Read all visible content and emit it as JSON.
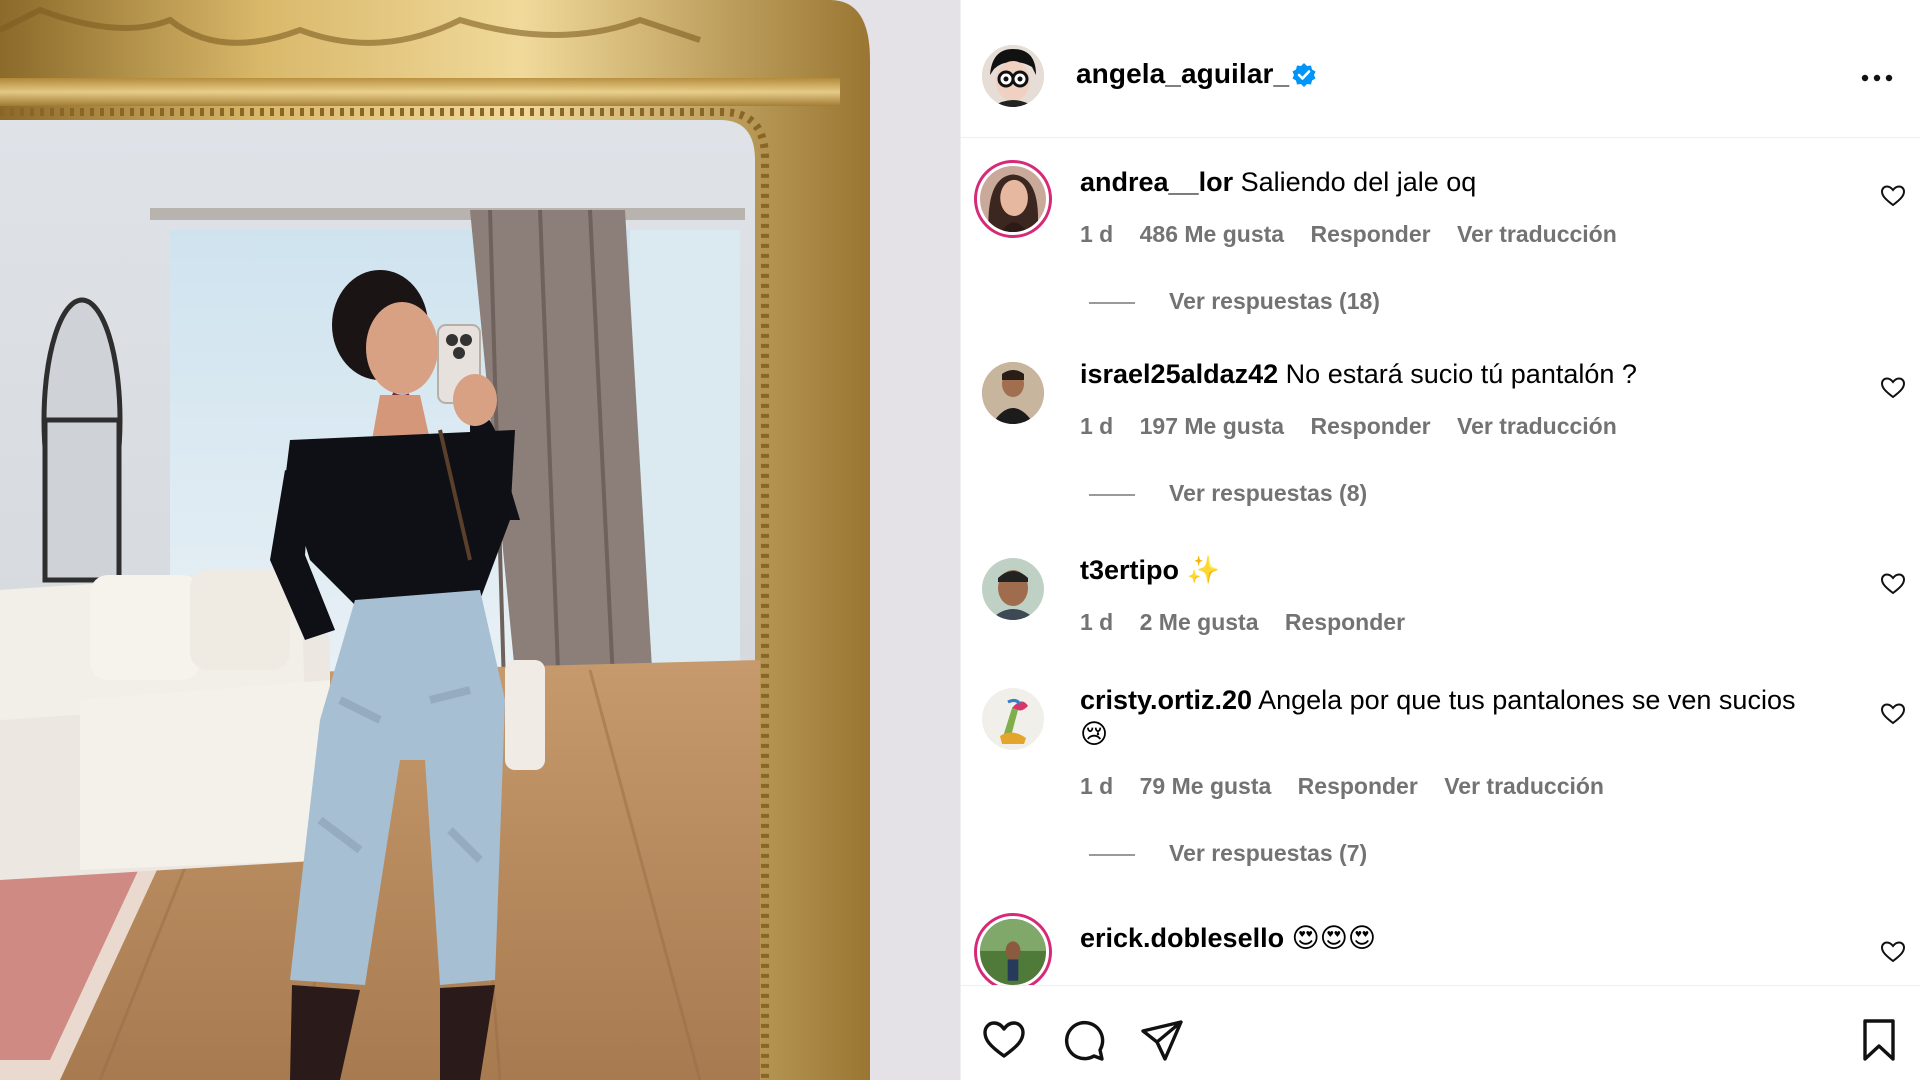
{
  "post": {
    "author": "angela_aguilar_",
    "verified": true,
    "more_icon": "more-horizontal-icon"
  },
  "comments": [
    {
      "user": "andrea__lor",
      "text": "Saliendo del jale oq",
      "time": "1 d",
      "likes": "486 Me gusta",
      "reply": "Responder",
      "translate": "Ver traducción",
      "replies": "Ver respuestas (18)",
      "story_ring": true
    },
    {
      "user": "israel25aldaz42",
      "text": "No estará sucio tú pantalón ?",
      "time": "1 d",
      "likes": "197 Me gusta",
      "reply": "Responder",
      "translate": "Ver traducción",
      "replies": "Ver respuestas (8)",
      "story_ring": false
    },
    {
      "user": "t3ertipo",
      "text": "✨",
      "time": "1 d",
      "likes": "2 Me gusta",
      "reply": "Responder",
      "story_ring": false
    },
    {
      "user": "cristy.ortiz.20",
      "text": "Angela por que tus pantalones se ven sucios 😢",
      "time": "1 d",
      "likes": "79 Me gusta",
      "reply": "Responder",
      "translate": "Ver traducción",
      "replies": "Ver respuestas (7)",
      "story_ring": false
    },
    {
      "user": "erick.doblesello",
      "text": "😍😍😍",
      "story_ring": true
    }
  ],
  "actions": [
    "heart-icon",
    "comment-icon",
    "share-icon",
    "bookmark-icon"
  ],
  "colors": {
    "verified": "#0095f6",
    "meta_text": "#737373",
    "story_ring": "#d62976"
  }
}
